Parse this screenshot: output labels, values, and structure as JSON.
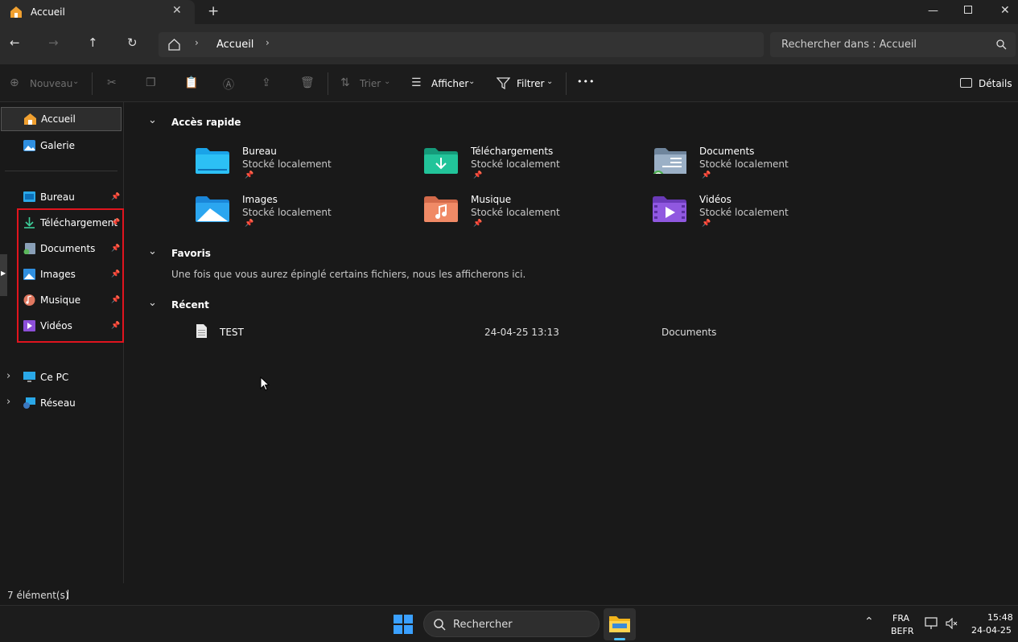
{
  "window": {
    "tab_title": "Accueil",
    "new_tab": "+"
  },
  "nav": {
    "breadcrumb_current": "Accueil",
    "search_placeholder": "Rechercher dans : Accueil"
  },
  "toolbar": {
    "new_label": "Nouveau",
    "sort_label": "Trier",
    "view_label": "Afficher",
    "filter_label": "Filtrer",
    "more_label": "•••",
    "details_label": "Détails"
  },
  "sidebar": {
    "top": [
      {
        "label": "Accueil"
      },
      {
        "label": "Galerie"
      }
    ],
    "pinned": [
      {
        "label": "Bureau"
      },
      {
        "label": "Téléchargement"
      },
      {
        "label": "Documents"
      },
      {
        "label": "Images"
      },
      {
        "label": "Musique"
      },
      {
        "label": "Vidéos"
      }
    ],
    "bottom": [
      {
        "label": "Ce PC"
      },
      {
        "label": "Réseau"
      }
    ]
  },
  "quick_access": {
    "title": "Accès rapide",
    "items": [
      {
        "name": "Bureau",
        "sub": "Stocké localement"
      },
      {
        "name": "Téléchargements",
        "sub": "Stocké localement"
      },
      {
        "name": "Documents",
        "sub": "Stocké localement"
      },
      {
        "name": "Images",
        "sub": "Stocké localement"
      },
      {
        "name": "Musique",
        "sub": "Stocké localement"
      },
      {
        "name": "Vidéos",
        "sub": "Stocké localement"
      }
    ]
  },
  "favorites": {
    "title": "Favoris",
    "empty_text": "Une fois que vous aurez épinglé certains fichiers, nous les afficherons ici."
  },
  "recent": {
    "title": "Récent",
    "rows": [
      {
        "name": "TEST",
        "date": "24-04-25 13:13",
        "location": "Documents"
      }
    ]
  },
  "status": {
    "count": "7 élément(s)"
  },
  "taskbar": {
    "search_placeholder": "Rechercher",
    "lang": "FRA",
    "layout": "BEFR",
    "time": "15:48",
    "date": "24-04-25"
  },
  "colors": {
    "highlight_box": "#e0141e",
    "selected_bg": "#2d2d2d",
    "accent": "#4cc2ff"
  }
}
